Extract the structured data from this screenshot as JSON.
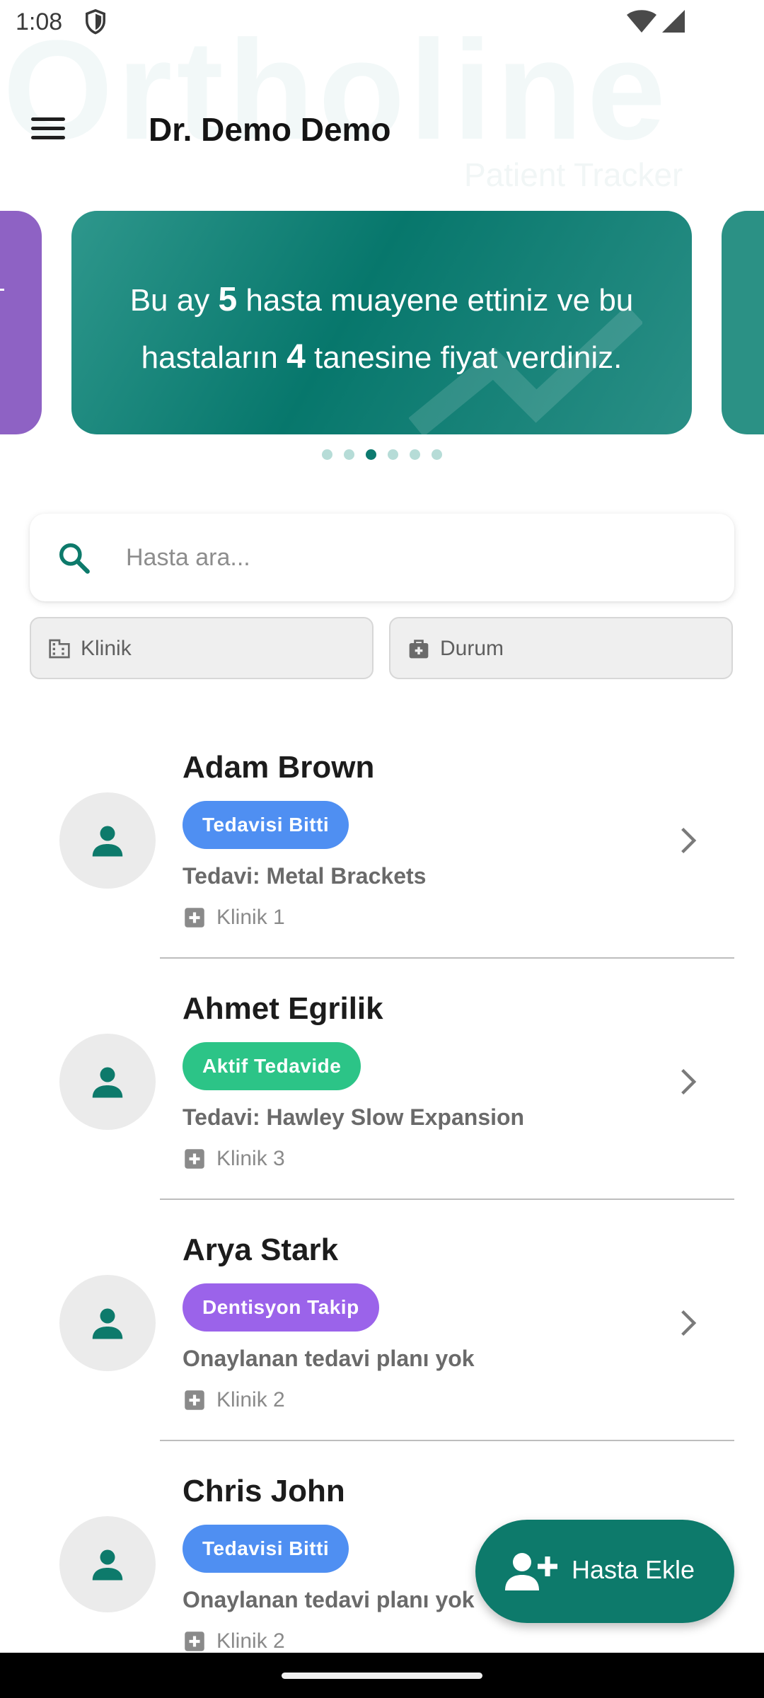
{
  "status_bar": {
    "time": "1:08"
  },
  "watermark": {
    "brand": "Ortholine",
    "tagline": "Patient Tracker"
  },
  "app_bar": {
    "title": "Dr. Demo Demo"
  },
  "banner": {
    "text_1": "Bu ay ",
    "examined_count": "5",
    "text_2": " hasta muayene ettiniz ve bu hastaların ",
    "priced_count": "4",
    "text_3": " tanesine fiyat verdiniz.",
    "total_slides": 6,
    "active_slide": 3
  },
  "search": {
    "placeholder": "Hasta ara...",
    "value": ""
  },
  "filters": {
    "klinik": "Klinik",
    "durum": "Durum"
  },
  "patients": [
    {
      "name": "Adam Brown",
      "status": "Tedavisi Bitti",
      "status_color": "#4f8ff2",
      "treatment": "Tedavi: Metal Brackets",
      "clinic": "Klinik 1"
    },
    {
      "name": "Ahmet Egrilik",
      "status": "Aktif Tedavide",
      "status_color": "#2cc487",
      "treatment": "Tedavi: Hawley Slow Expansion",
      "clinic": "Klinik 3"
    },
    {
      "name": "Arya Stark",
      "status": "Dentisyon Takip",
      "status_color": "#9b63ea",
      "treatment": "Onaylanan tedavi planı yok",
      "clinic": "Klinik 2"
    },
    {
      "name": "Chris John",
      "status": "Tedavisi Bitti",
      "status_color": "#4f8ff2",
      "treatment": "Onaylanan tedavi planı yok",
      "clinic": "Klinik 2"
    }
  ],
  "fab": {
    "label": "Hasta Ekle"
  },
  "colors": {
    "primary": "#0d7a6b",
    "banner_prev": "#8e62c4"
  },
  "icons": {
    "menu": "menu-icon",
    "search": "search-icon",
    "klinik": "building-icon",
    "durum": "briefcase-medical-icon",
    "avatar": "person-icon",
    "clinic": "medical-cross-icon",
    "chevron": "chevron-right-icon",
    "fab": "person-add-icon"
  }
}
